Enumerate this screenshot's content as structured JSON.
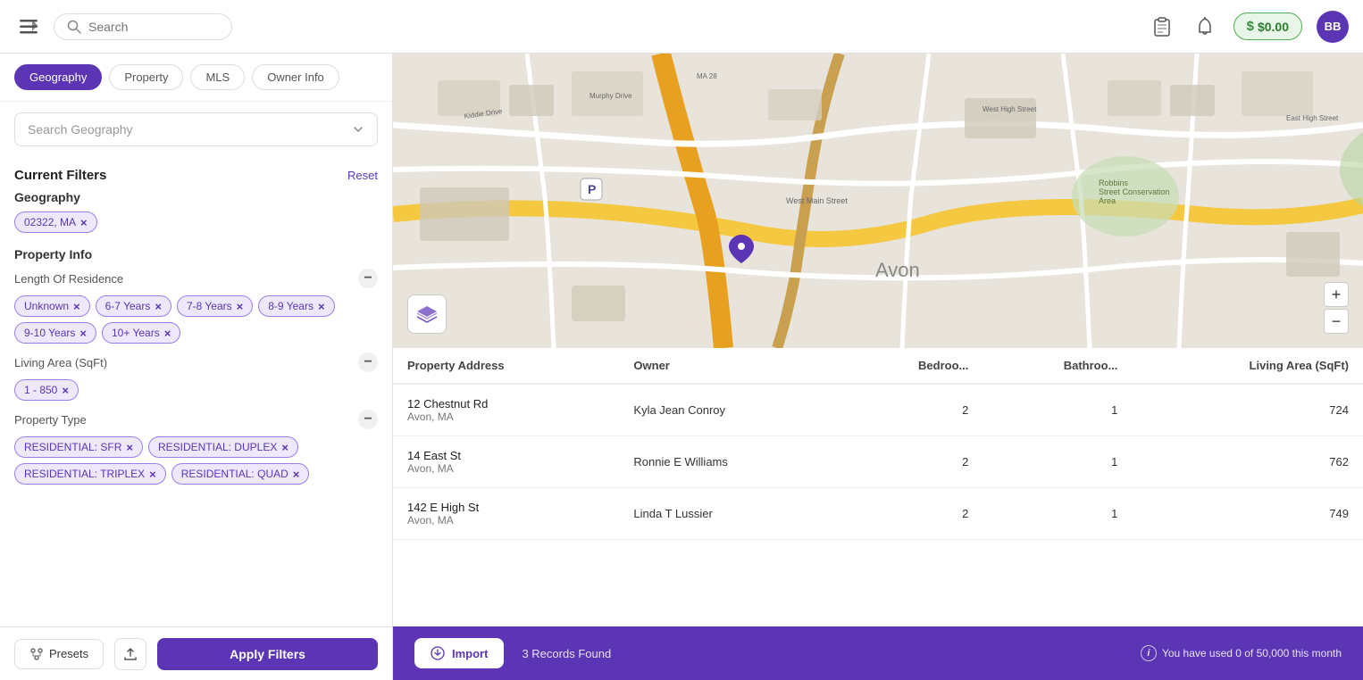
{
  "header": {
    "search_placeholder": "Search",
    "balance_label": "$0.00",
    "avatar_initials": "BB"
  },
  "sidebar": {
    "tabs": [
      {
        "id": "geography",
        "label": "Geography",
        "active": true
      },
      {
        "id": "property",
        "label": "Property",
        "active": false
      },
      {
        "id": "mls",
        "label": "MLS",
        "active": false
      },
      {
        "id": "owner_info",
        "label": "Owner Info",
        "active": false
      }
    ],
    "search_geography_placeholder": "Search Geography",
    "current_filters_title": "Current Filters",
    "reset_label": "Reset",
    "geography_group": {
      "title": "Geography",
      "tags": [
        "02322, MA"
      ]
    },
    "property_info_group": {
      "title": "Property Info",
      "length_of_residence_label": "Length Of Residence",
      "lor_tags": [
        "Unknown",
        "6-7 Years",
        "7-8 Years",
        "8-9 Years",
        "9-10 Years",
        "10+ Years"
      ],
      "living_area_label": "Living Area (SqFt)",
      "living_area_tags": [
        "1 - 850"
      ],
      "property_type_label": "Property Type",
      "property_type_tags": [
        "RESIDENTIAL: SFR",
        "RESIDENTIAL: DUPLEX",
        "RESIDENTIAL: TRIPLEX",
        "RESIDENTIAL: QUAD"
      ]
    },
    "presets_label": "Presets",
    "apply_filters_label": "Apply Filters"
  },
  "table": {
    "columns": [
      "Property Address",
      "Owner",
      "Bedroo...",
      "Bathroo...",
      "Living Area (SqFt)"
    ],
    "rows": [
      {
        "address1": "12 Chestnut Rd",
        "address2": "Avon, MA",
        "owner": "Kyla Jean Conroy",
        "bedrooms": "2",
        "bathrooms": "1",
        "living_area": "724"
      },
      {
        "address1": "14 East St",
        "address2": "Avon, MA",
        "owner": "Ronnie E Williams",
        "bedrooms": "2",
        "bathrooms": "1",
        "living_area": "762"
      },
      {
        "address1": "142 E High St",
        "address2": "Avon, MA",
        "owner": "Linda T Lussier",
        "bedrooms": "2",
        "bathrooms": "1",
        "living_area": "749"
      }
    ]
  },
  "bottom_bar": {
    "import_label": "Import",
    "records_found": "3 Records Found",
    "usage_text": "You have used 0 of 50,000 this month"
  }
}
